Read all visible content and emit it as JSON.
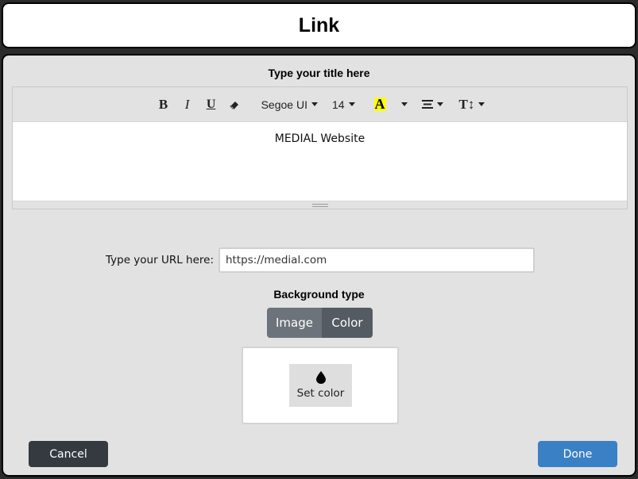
{
  "dialog": {
    "title": "Link"
  },
  "title_field": {
    "label": "Type your title here",
    "content": "MEDIAL Website"
  },
  "toolbar": {
    "bold": "B",
    "italic": "I",
    "underline": "U",
    "font_family": "Segoe UI",
    "font_size": "14",
    "highlight": "A",
    "highlight_color": "#ffff00",
    "line_height": "T↕"
  },
  "url": {
    "label": "Type your URL here:",
    "value": "https://medial.com",
    "placeholder": "https://medial.com"
  },
  "background": {
    "label": "Background type",
    "options": [
      "Image",
      "Color"
    ],
    "selected": "Color",
    "set_color_label": "Set color"
  },
  "actions": {
    "cancel": "Cancel",
    "done": "Done"
  },
  "colors": {
    "panel": "#e2e2e2",
    "cancel": "#343a40",
    "done": "#3a80c4",
    "segment_inactive": "#6c737a",
    "segment_active": "#545b62"
  }
}
